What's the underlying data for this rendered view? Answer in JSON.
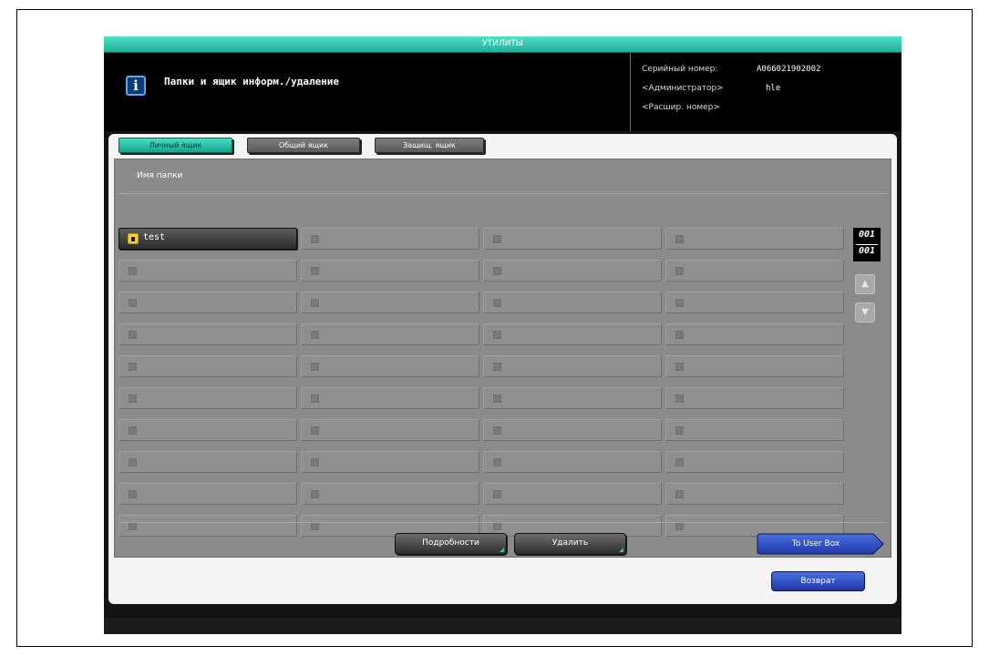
{
  "title_bar": {
    "title": "УТИЛИТЫ"
  },
  "header": {
    "info_icon": "i",
    "screen_title": "Папки и ящик информ./удаление",
    "serial_label": "Серийный номер:",
    "serial_value": "A066021902002",
    "admin_label": "<Администратор>",
    "admin_value": "hle",
    "ext_number_label": "<Расшир. номер>"
  },
  "tabs": [
    {
      "label": "Личный ящик",
      "active": true
    },
    {
      "label": "Общий ящик",
      "active": false
    },
    {
      "label": "Защищ. ящик",
      "active": false
    }
  ],
  "list": {
    "column_header": "Имя папки",
    "folders": [
      {
        "name": "test",
        "locked": true
      }
    ],
    "rows": 10,
    "cols": 4
  },
  "pager": {
    "current": "001",
    "total": "001"
  },
  "buttons": {
    "details": "Подробности",
    "delete": "Удалить",
    "to_user_box": "To User Box",
    "back": "Возврат"
  },
  "colors": {
    "accent_teal": "#1fae98",
    "button_blue": "#1f3aa8",
    "lock_yellow": "#f2d23b"
  }
}
